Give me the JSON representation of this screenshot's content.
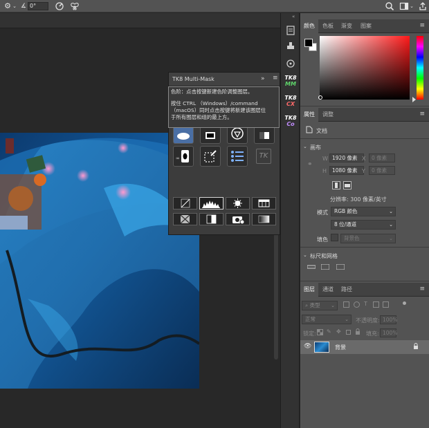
{
  "options_bar": {
    "angle_value": "0°"
  },
  "tk8_panel": {
    "title": "TK8 Multi-Mask",
    "tooltip_line1": "色阶：点击按键新建色阶调整图层。",
    "tooltip_line2": "按住 CTRL （Windows）/command",
    "tooltip_line3": "（macOS）同时点击按键将新建该图层位",
    "tooltip_line4": "于所有图层和组的最上方。",
    "tk_logo": "TK"
  },
  "side_strip": {
    "badges": [
      "TK8 MM",
      "TK8 CX",
      "TK8 Co"
    ]
  },
  "color_panel": {
    "tabs": [
      "颜色",
      "色板",
      "渐变",
      "图案"
    ],
    "foreground": "#000000",
    "background": "#ffffff"
  },
  "properties_panel": {
    "tabs": [
      "属性",
      "调整"
    ],
    "doc_label": "文档",
    "section_canvas": "画布",
    "w_label": "W",
    "w_value": "1920 像素",
    "x_label": "X",
    "x_placeholder": "0 像素",
    "h_label": "H",
    "h_value": "1080 像素",
    "y_label": "Y",
    "y_placeholder": "0 像素",
    "resolution": "分辨率: 300 像素/英寸",
    "mode_label": "模式",
    "mode_value": "RGB 颜色",
    "depth_value": "8 位/通道",
    "fill_label": "填色",
    "fill_value": "背景色",
    "section_rulers": "标尺和网格"
  },
  "layers_panel": {
    "tabs": [
      "图层",
      "通道",
      "路径"
    ],
    "filter_kind": "类型",
    "blend_mode": "正常",
    "opacity_label": "不透明度:",
    "opacity_value": "100%",
    "lock_label": "锁定:",
    "fill_label": "填充:",
    "fill_value": "100%",
    "layer_name": "背景"
  }
}
